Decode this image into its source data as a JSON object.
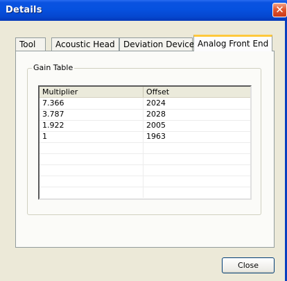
{
  "window": {
    "title": "Details",
    "close_glyph": "✕"
  },
  "tabs": [
    {
      "label": "Tool"
    },
    {
      "label": "Acoustic Head"
    },
    {
      "label": "Deviation Device"
    },
    {
      "label": "Analog Front End",
      "active": true
    }
  ],
  "gain_table": {
    "group_label": "Gain Table",
    "columns": [
      "Multiplier",
      "Offset"
    ],
    "rows": [
      [
        "7.366",
        "2024"
      ],
      [
        "3.787",
        "2028"
      ],
      [
        "1.922",
        "2005"
      ],
      [
        "1",
        "1963"
      ]
    ]
  },
  "footer": {
    "close_label": "Close"
  },
  "colors": {
    "titlebar": "#0651df",
    "active_tab_accent": "#ffc83c",
    "close_button": "#e2572e"
  }
}
